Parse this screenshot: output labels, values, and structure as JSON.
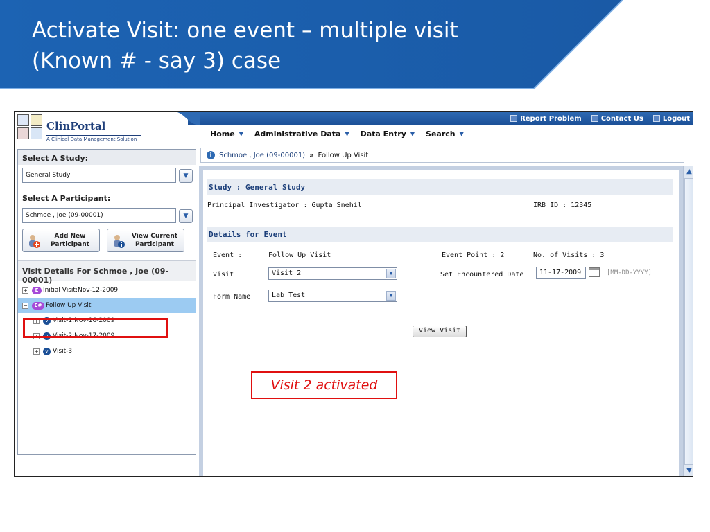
{
  "slide": {
    "title_line1": "Activate Visit: one event – multiple visit",
    "title_line2": "(Known # - say 3) case"
  },
  "app": {
    "logo_name": "ClinPortal",
    "logo_tag": "A Clinical Data Management Solution",
    "top_links": {
      "report": "Report Problem",
      "contact": "Contact Us",
      "logout": "Logout"
    },
    "menu": {
      "home": "Home",
      "admin": "Administrative Data",
      "data_entry": "Data Entry",
      "search": "Search"
    },
    "left": {
      "select_study_label": "Select A Study:",
      "study_value": "General Study",
      "select_participant_label": "Select A Participant:",
      "participant_value": "Schmoe , Joe (09-00001)",
      "add_new_line1": "Add New",
      "add_new_line2": "Participant",
      "view_current_line1": "View Current",
      "view_current_line2": "Participant",
      "visit_details_head": "Visit Details For  Schmoe , Joe (09-00001)",
      "tree": {
        "n1_badge": "E",
        "n1_label": "Initial Visit:Nov-12-2009",
        "n2_badge": "E#",
        "n2_label": "Follow Up Visit",
        "n3_label": "Visit-1:Nov-16-2009",
        "n4_label": "Visit-2:Nov-17-2009",
        "n5_label": "Visit-3"
      }
    },
    "breadcrumb": {
      "participant": "Schmoe , Joe (09-00001)",
      "separator": "»",
      "current": "Follow Up Visit"
    },
    "study": {
      "section_title": "Study : General Study",
      "pi": "Principal Investigator : Gupta Snehil",
      "irb": "IRB ID : 12345"
    },
    "event": {
      "section_title": "Details for Event",
      "event_label": "Event :",
      "event_value": "Follow Up Visit",
      "event_point": "Event Point : 2",
      "num_visits": "No. of Visits : 3",
      "visit_label": "Visit",
      "visit_value": "Visit 2",
      "encounter_label": "Set Encountered Date",
      "encounter_date": "11-17-2009",
      "date_hint": "[MM-DD-YYYY]",
      "form_label": "Form Name",
      "form_value": "Lab Test",
      "view_button": "View Visit"
    }
  },
  "callout": "Visit 2 activated",
  "colors": {
    "banner": "#1b5fae",
    "highlight": "#e01010",
    "selected_row": "#9ccbf2"
  }
}
